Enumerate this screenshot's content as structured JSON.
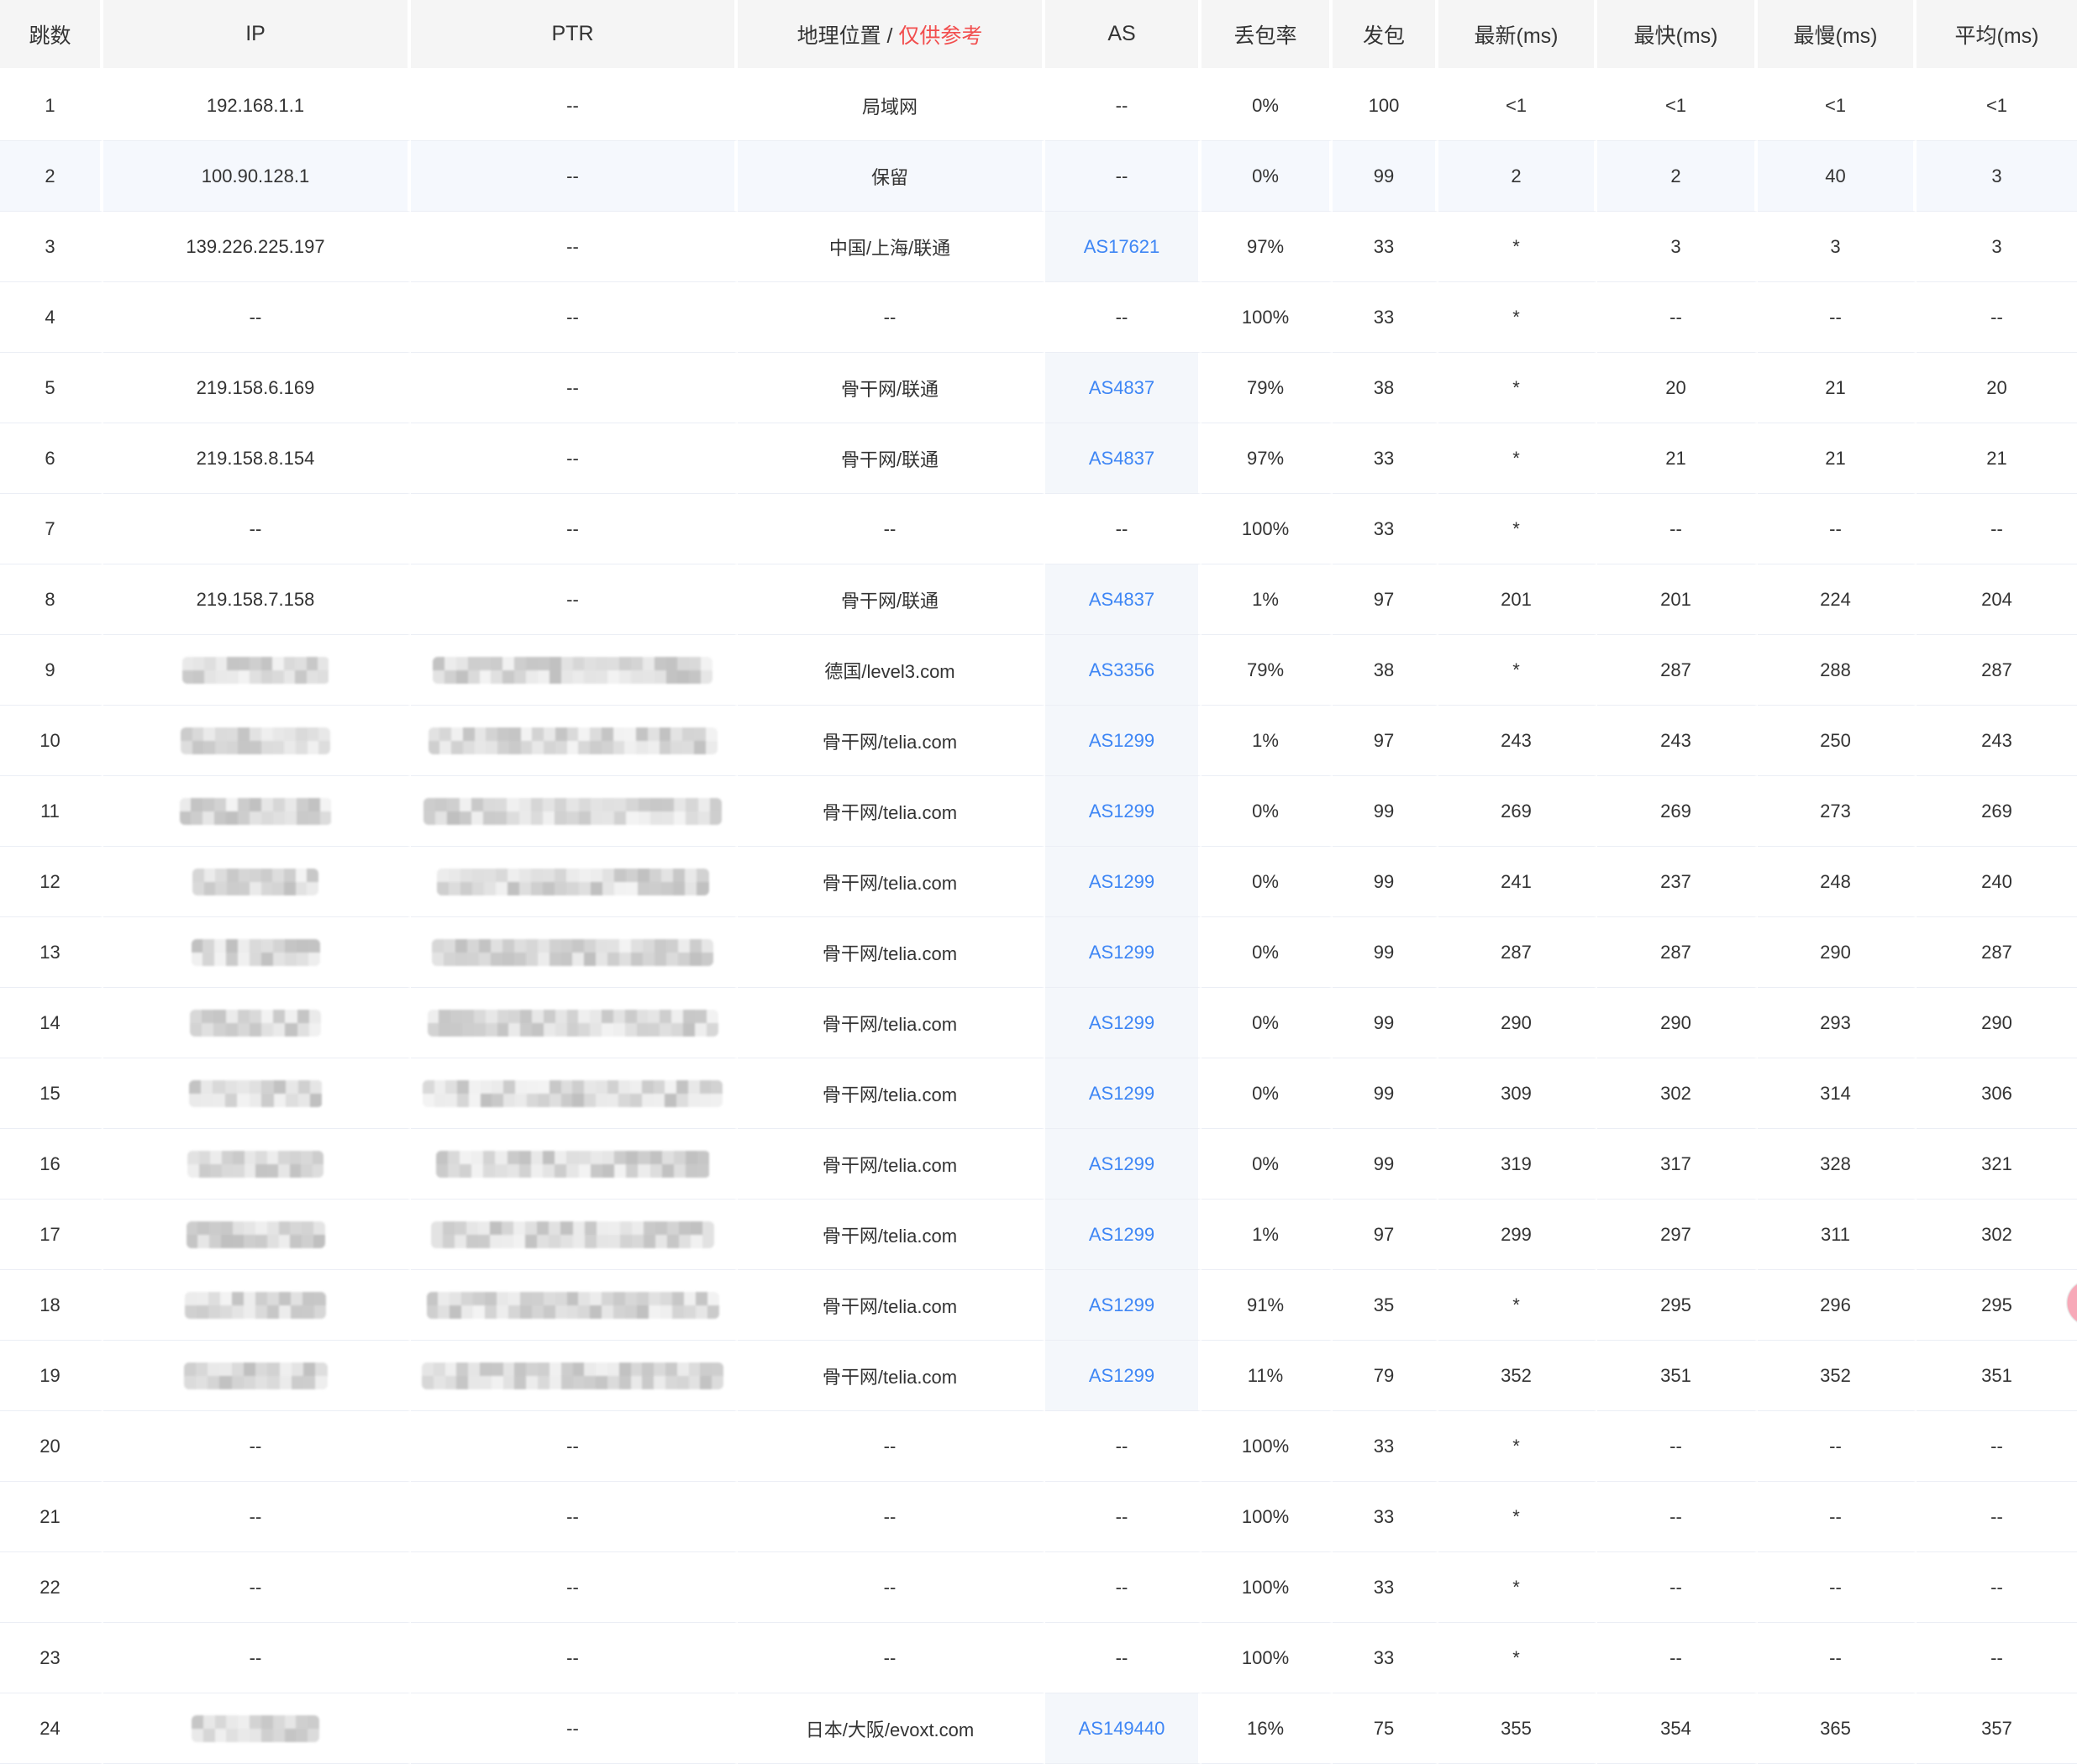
{
  "header": {
    "hop": "跳数",
    "ip": "IP",
    "ptr": "PTR",
    "geo_label": "地理位置 / ",
    "geo_note": "仅供参考",
    "as": "AS",
    "loss": "丢包率",
    "sent": "发包",
    "last": "最新(ms)",
    "best": "最快(ms)",
    "worst": "最慢(ms)",
    "avg": "平均(ms)"
  },
  "colors": {
    "text": "#333333",
    "header_bg": "#f5f5f5",
    "border": "#ebeef5",
    "link": "#3e86f5",
    "note": "#f24e4e",
    "as_cell_bg": "#f4f7fb",
    "highlight_bg": "#f5f8fd",
    "floating_button": "#f7a9b8"
  },
  "rows": [
    {
      "hop": "1",
      "ip": "192.168.1.1",
      "ptr": "--",
      "geo": "局域网",
      "as": "--",
      "loss": "0%",
      "sent": "100",
      "last": "<1",
      "best": "<1",
      "worst": "<1",
      "avg": "<1"
    },
    {
      "hop": "2",
      "ip": "100.90.128.1",
      "ptr": "--",
      "geo": "保留",
      "as": "--",
      "loss": "0%",
      "sent": "99",
      "last": "2",
      "best": "2",
      "worst": "40",
      "avg": "3",
      "highlighted": true
    },
    {
      "hop": "3",
      "ip": "139.226.225.197",
      "ptr": "--",
      "geo": "中国/上海/联通",
      "as": "AS17621",
      "loss": "97%",
      "sent": "33",
      "last": "*",
      "best": "3",
      "worst": "3",
      "avg": "3"
    },
    {
      "hop": "4",
      "ip": "--",
      "ptr": "--",
      "geo": "--",
      "as": "--",
      "loss": "100%",
      "sent": "33",
      "last": "*",
      "best": "--",
      "worst": "--",
      "avg": "--"
    },
    {
      "hop": "5",
      "ip": "219.158.6.169",
      "ptr": "--",
      "geo": "骨干网/联通",
      "as": "AS4837",
      "loss": "79%",
      "sent": "38",
      "last": "*",
      "best": "20",
      "worst": "21",
      "avg": "20"
    },
    {
      "hop": "6",
      "ip": "219.158.8.154",
      "ptr": "--",
      "geo": "骨干网/联通",
      "as": "AS4837",
      "loss": "97%",
      "sent": "33",
      "last": "*",
      "best": "21",
      "worst": "21",
      "avg": "21"
    },
    {
      "hop": "7",
      "ip": "--",
      "ptr": "--",
      "geo": "--",
      "as": "--",
      "loss": "100%",
      "sent": "33",
      "last": "*",
      "best": "--",
      "worst": "--",
      "avg": "--"
    },
    {
      "hop": "8",
      "ip": "219.158.7.158",
      "ptr": "--",
      "geo": "骨干网/联通",
      "as": "AS4837",
      "loss": "1%",
      "sent": "97",
      "last": "201",
      "best": "201",
      "worst": "224",
      "avg": "204"
    },
    {
      "hop": "9",
      "ip_masked": true,
      "ptr_masked": true,
      "geo": "德国/level3.com",
      "as": "AS3356",
      "loss": "79%",
      "sent": "38",
      "last": "*",
      "best": "287",
      "worst": "288",
      "avg": "287"
    },
    {
      "hop": "10",
      "ip_masked": true,
      "ptr_masked": true,
      "geo": "骨干网/telia.com",
      "as": "AS1299",
      "loss": "1%",
      "sent": "97",
      "last": "243",
      "best": "243",
      "worst": "250",
      "avg": "243"
    },
    {
      "hop": "11",
      "ip_masked": true,
      "ptr_masked": true,
      "geo": "骨干网/telia.com",
      "as": "AS1299",
      "loss": "0%",
      "sent": "99",
      "last": "269",
      "best": "269",
      "worst": "273",
      "avg": "269"
    },
    {
      "hop": "12",
      "ip_masked": true,
      "ptr_masked": true,
      "geo": "骨干网/telia.com",
      "as": "AS1299",
      "loss": "0%",
      "sent": "99",
      "last": "241",
      "best": "237",
      "worst": "248",
      "avg": "240"
    },
    {
      "hop": "13",
      "ip_masked": true,
      "ptr_masked": true,
      "geo": "骨干网/telia.com",
      "as": "AS1299",
      "loss": "0%",
      "sent": "99",
      "last": "287",
      "best": "287",
      "worst": "290",
      "avg": "287"
    },
    {
      "hop": "14",
      "ip_masked": true,
      "ptr_masked": true,
      "geo": "骨干网/telia.com",
      "as": "AS1299",
      "loss": "0%",
      "sent": "99",
      "last": "290",
      "best": "290",
      "worst": "293",
      "avg": "290"
    },
    {
      "hop": "15",
      "ip_masked": true,
      "ptr_masked": true,
      "geo": "骨干网/telia.com",
      "as": "AS1299",
      "loss": "0%",
      "sent": "99",
      "last": "309",
      "best": "302",
      "worst": "314",
      "avg": "306"
    },
    {
      "hop": "16",
      "ip_masked": true,
      "ptr_masked": true,
      "geo": "骨干网/telia.com",
      "as": "AS1299",
      "loss": "0%",
      "sent": "99",
      "last": "319",
      "best": "317",
      "worst": "328",
      "avg": "321"
    },
    {
      "hop": "17",
      "ip_masked": true,
      "ptr_masked": true,
      "geo": "骨干网/telia.com",
      "as": "AS1299",
      "loss": "1%",
      "sent": "97",
      "last": "299",
      "best": "297",
      "worst": "311",
      "avg": "302"
    },
    {
      "hop": "18",
      "ip_masked": true,
      "ptr_masked": true,
      "geo": "骨干网/telia.com",
      "as": "AS1299",
      "loss": "91%",
      "sent": "35",
      "last": "*",
      "best": "295",
      "worst": "296",
      "avg": "295"
    },
    {
      "hop": "19",
      "ip_masked": true,
      "ptr_masked": true,
      "geo": "骨干网/telia.com",
      "as": "AS1299",
      "loss": "11%",
      "sent": "79",
      "last": "352",
      "best": "351",
      "worst": "352",
      "avg": "351"
    },
    {
      "hop": "20",
      "ip": "--",
      "ptr": "--",
      "geo": "--",
      "as": "--",
      "loss": "100%",
      "sent": "33",
      "last": "*",
      "best": "--",
      "worst": "--",
      "avg": "--"
    },
    {
      "hop": "21",
      "ip": "--",
      "ptr": "--",
      "geo": "--",
      "as": "--",
      "loss": "100%",
      "sent": "33",
      "last": "*",
      "best": "--",
      "worst": "--",
      "avg": "--"
    },
    {
      "hop": "22",
      "ip": "--",
      "ptr": "--",
      "geo": "--",
      "as": "--",
      "loss": "100%",
      "sent": "33",
      "last": "*",
      "best": "--",
      "worst": "--",
      "avg": "--"
    },
    {
      "hop": "23",
      "ip": "--",
      "ptr": "--",
      "geo": "--",
      "as": "--",
      "loss": "100%",
      "sent": "33",
      "last": "*",
      "best": "--",
      "worst": "--",
      "avg": "--"
    },
    {
      "hop": "24",
      "ip_masked": true,
      "ptr": "--",
      "geo": "日本/大阪/evoxt.com",
      "as": "AS149440",
      "loss": "16%",
      "sent": "75",
      "last": "355",
      "best": "354",
      "worst": "365",
      "avg": "357"
    }
  ]
}
